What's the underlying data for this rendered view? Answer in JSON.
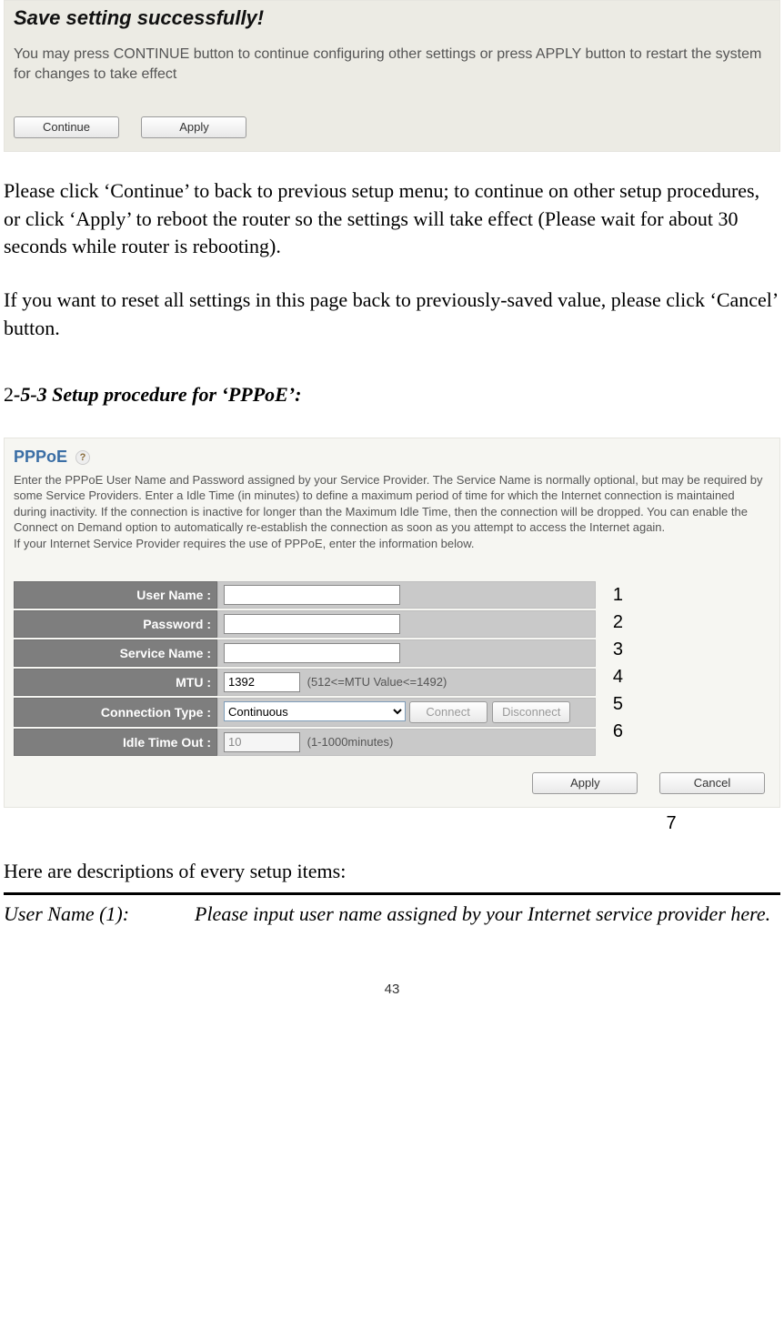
{
  "shot1": {
    "success": "Save setting successfully!",
    "desc": "You may press CONTINUE button to continue configuring other settings or press APPLY button to restart the system for changes to take effect",
    "continue_label": "Continue",
    "apply_label": "Apply"
  },
  "para1": "Please click ‘Continue’ to back to previous setup menu; to continue on other setup procedures, or click ‘Apply’ to reboot the router so the settings will take effect (Please wait for about 30 seconds while router is rebooting).",
  "para2": "If you want to reset all settings in this page back to previously-saved value, please click ‘Cancel’ button.",
  "section": {
    "num": "2",
    "rest": "-5-3 Setup procedure for ‘PPPoE’:"
  },
  "shot2": {
    "title": "PPPoE",
    "help_glyph": "?",
    "blurb": "Enter the PPPoE User Name and Password assigned by your Service Provider. The Service Name is normally optional, but may be required by some Service Providers. Enter a Idle Time (in minutes) to define a maximum period of time for which the Internet connection is maintained during inactivity. If the connection is inactive for longer than the Maximum Idle Time, then the connection will be dropped. You can enable the Connect on Demand option to automatically re-establish the connection as soon as you attempt to access the Internet again.\nIf your Internet Service Provider requires the use of PPPoE, enter the information below.",
    "fields": {
      "user_label": "User Name :",
      "user_value": "",
      "pass_label": "Password :",
      "pass_value": "",
      "svc_label": "Service Name :",
      "svc_value": "",
      "mtu_label": "MTU :",
      "mtu_value": "1392",
      "mtu_hint": "(512<=MTU Value<=1492)",
      "conn_label": "Connection Type :",
      "conn_value": "Continuous",
      "connect_btn": "Connect",
      "disconnect_btn": "Disconnect",
      "idle_label": "Idle Time Out :",
      "idle_value": "10",
      "idle_hint": "(1-1000minutes)"
    },
    "nums": {
      "n1": "1",
      "n2": "2",
      "n3": "3",
      "n4": "4",
      "n5": "5",
      "n6": "6",
      "n7": "7"
    },
    "apply_label": "Apply",
    "cancel_label": "Cancel"
  },
  "table_desc": "Here are descriptions of every setup items:",
  "def1_key": "User Name (1):",
  "def1_val": "Please input user name assigned by your Internet service provider here.",
  "page_number": "43"
}
